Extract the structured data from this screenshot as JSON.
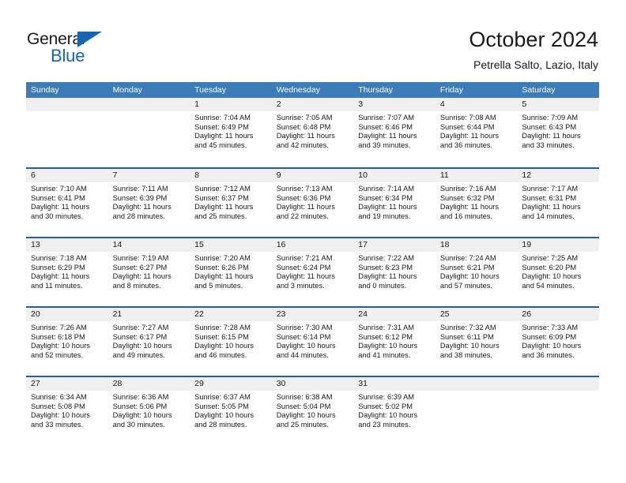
{
  "brand": {
    "name_top": "General",
    "name_bottom": "Blue",
    "triangle_icon": "triangle-icon",
    "accent_color": "#1565b0"
  },
  "header": {
    "title": "October 2024",
    "subtitle": "Petrella Salto, Lazio, Italy"
  },
  "colors": {
    "header_bar": "#3b7cb9",
    "row_separator": "#1f5fa4",
    "date_band": "#f0f0f0",
    "text": "#1a1a1a"
  },
  "weekday_headers": [
    "Sunday",
    "Monday",
    "Tuesday",
    "Wednesday",
    "Thursday",
    "Friday",
    "Saturday"
  ],
  "weeks": [
    [
      {
        "day": "",
        "sunrise": "",
        "sunset": "",
        "daylight_line1": "",
        "daylight_line2": "",
        "empty": true
      },
      {
        "day": "",
        "sunrise": "",
        "sunset": "",
        "daylight_line1": "",
        "daylight_line2": "",
        "empty": true
      },
      {
        "day": "1",
        "sunrise": "Sunrise: 7:04 AM",
        "sunset": "Sunset: 6:49 PM",
        "daylight_line1": "Daylight: 11 hours",
        "daylight_line2": "and 45 minutes."
      },
      {
        "day": "2",
        "sunrise": "Sunrise: 7:05 AM",
        "sunset": "Sunset: 6:48 PM",
        "daylight_line1": "Daylight: 11 hours",
        "daylight_line2": "and 42 minutes."
      },
      {
        "day": "3",
        "sunrise": "Sunrise: 7:07 AM",
        "sunset": "Sunset: 6:46 PM",
        "daylight_line1": "Daylight: 11 hours",
        "daylight_line2": "and 39 minutes."
      },
      {
        "day": "4",
        "sunrise": "Sunrise: 7:08 AM",
        "sunset": "Sunset: 6:44 PM",
        "daylight_line1": "Daylight: 11 hours",
        "daylight_line2": "and 36 minutes."
      },
      {
        "day": "5",
        "sunrise": "Sunrise: 7:09 AM",
        "sunset": "Sunset: 6:43 PM",
        "daylight_line1": "Daylight: 11 hours",
        "daylight_line2": "and 33 minutes."
      }
    ],
    [
      {
        "day": "6",
        "sunrise": "Sunrise: 7:10 AM",
        "sunset": "Sunset: 6:41 PM",
        "daylight_line1": "Daylight: 11 hours",
        "daylight_line2": "and 30 minutes."
      },
      {
        "day": "7",
        "sunrise": "Sunrise: 7:11 AM",
        "sunset": "Sunset: 6:39 PM",
        "daylight_line1": "Daylight: 11 hours",
        "daylight_line2": "and 28 minutes."
      },
      {
        "day": "8",
        "sunrise": "Sunrise: 7:12 AM",
        "sunset": "Sunset: 6:37 PM",
        "daylight_line1": "Daylight: 11 hours",
        "daylight_line2": "and 25 minutes."
      },
      {
        "day": "9",
        "sunrise": "Sunrise: 7:13 AM",
        "sunset": "Sunset: 6:36 PM",
        "daylight_line1": "Daylight: 11 hours",
        "daylight_line2": "and 22 minutes."
      },
      {
        "day": "10",
        "sunrise": "Sunrise: 7:14 AM",
        "sunset": "Sunset: 6:34 PM",
        "daylight_line1": "Daylight: 11 hours",
        "daylight_line2": "and 19 minutes."
      },
      {
        "day": "11",
        "sunrise": "Sunrise: 7:16 AM",
        "sunset": "Sunset: 6:32 PM",
        "daylight_line1": "Daylight: 11 hours",
        "daylight_line2": "and 16 minutes."
      },
      {
        "day": "12",
        "sunrise": "Sunrise: 7:17 AM",
        "sunset": "Sunset: 6:31 PM",
        "daylight_line1": "Daylight: 11 hours",
        "daylight_line2": "and 14 minutes."
      }
    ],
    [
      {
        "day": "13",
        "sunrise": "Sunrise: 7:18 AM",
        "sunset": "Sunset: 6:29 PM",
        "daylight_line1": "Daylight: 11 hours",
        "daylight_line2": "and 11 minutes."
      },
      {
        "day": "14",
        "sunrise": "Sunrise: 7:19 AM",
        "sunset": "Sunset: 6:27 PM",
        "daylight_line1": "Daylight: 11 hours",
        "daylight_line2": "and 8 minutes."
      },
      {
        "day": "15",
        "sunrise": "Sunrise: 7:20 AM",
        "sunset": "Sunset: 6:26 PM",
        "daylight_line1": "Daylight: 11 hours",
        "daylight_line2": "and 5 minutes."
      },
      {
        "day": "16",
        "sunrise": "Sunrise: 7:21 AM",
        "sunset": "Sunset: 6:24 PM",
        "daylight_line1": "Daylight: 11 hours",
        "daylight_line2": "and 3 minutes."
      },
      {
        "day": "17",
        "sunrise": "Sunrise: 7:22 AM",
        "sunset": "Sunset: 6:23 PM",
        "daylight_line1": "Daylight: 11 hours",
        "daylight_line2": "and 0 minutes."
      },
      {
        "day": "18",
        "sunrise": "Sunrise: 7:24 AM",
        "sunset": "Sunset: 6:21 PM",
        "daylight_line1": "Daylight: 10 hours",
        "daylight_line2": "and 57 minutes."
      },
      {
        "day": "19",
        "sunrise": "Sunrise: 7:25 AM",
        "sunset": "Sunset: 6:20 PM",
        "daylight_line1": "Daylight: 10 hours",
        "daylight_line2": "and 54 minutes."
      }
    ],
    [
      {
        "day": "20",
        "sunrise": "Sunrise: 7:26 AM",
        "sunset": "Sunset: 6:18 PM",
        "daylight_line1": "Daylight: 10 hours",
        "daylight_line2": "and 52 minutes."
      },
      {
        "day": "21",
        "sunrise": "Sunrise: 7:27 AM",
        "sunset": "Sunset: 6:17 PM",
        "daylight_line1": "Daylight: 10 hours",
        "daylight_line2": "and 49 minutes."
      },
      {
        "day": "22",
        "sunrise": "Sunrise: 7:28 AM",
        "sunset": "Sunset: 6:15 PM",
        "daylight_line1": "Daylight: 10 hours",
        "daylight_line2": "and 46 minutes."
      },
      {
        "day": "23",
        "sunrise": "Sunrise: 7:30 AM",
        "sunset": "Sunset: 6:14 PM",
        "daylight_line1": "Daylight: 10 hours",
        "daylight_line2": "and 44 minutes."
      },
      {
        "day": "24",
        "sunrise": "Sunrise: 7:31 AM",
        "sunset": "Sunset: 6:12 PM",
        "daylight_line1": "Daylight: 10 hours",
        "daylight_line2": "and 41 minutes."
      },
      {
        "day": "25",
        "sunrise": "Sunrise: 7:32 AM",
        "sunset": "Sunset: 6:11 PM",
        "daylight_line1": "Daylight: 10 hours",
        "daylight_line2": "and 38 minutes."
      },
      {
        "day": "26",
        "sunrise": "Sunrise: 7:33 AM",
        "sunset": "Sunset: 6:09 PM",
        "daylight_line1": "Daylight: 10 hours",
        "daylight_line2": "and 36 minutes."
      }
    ],
    [
      {
        "day": "27",
        "sunrise": "Sunrise: 6:34 AM",
        "sunset": "Sunset: 5:08 PM",
        "daylight_line1": "Daylight: 10 hours",
        "daylight_line2": "and 33 minutes."
      },
      {
        "day": "28",
        "sunrise": "Sunrise: 6:36 AM",
        "sunset": "Sunset: 5:06 PM",
        "daylight_line1": "Daylight: 10 hours",
        "daylight_line2": "and 30 minutes."
      },
      {
        "day": "29",
        "sunrise": "Sunrise: 6:37 AM",
        "sunset": "Sunset: 5:05 PM",
        "daylight_line1": "Daylight: 10 hours",
        "daylight_line2": "and 28 minutes."
      },
      {
        "day": "30",
        "sunrise": "Sunrise: 6:38 AM",
        "sunset": "Sunset: 5:04 PM",
        "daylight_line1": "Daylight: 10 hours",
        "daylight_line2": "and 25 minutes."
      },
      {
        "day": "31",
        "sunrise": "Sunrise: 6:39 AM",
        "sunset": "Sunset: 5:02 PM",
        "daylight_line1": "Daylight: 10 hours",
        "daylight_line2": "and 23 minutes."
      },
      {
        "day": "",
        "sunrise": "",
        "sunset": "",
        "daylight_line1": "",
        "daylight_line2": "",
        "empty": true
      },
      {
        "day": "",
        "sunrise": "",
        "sunset": "",
        "daylight_line1": "",
        "daylight_line2": "",
        "empty": true
      }
    ]
  ]
}
